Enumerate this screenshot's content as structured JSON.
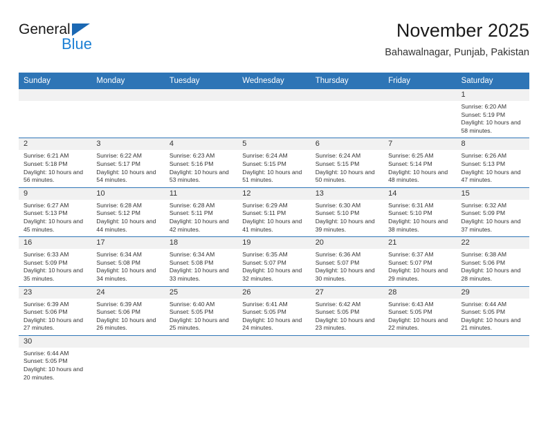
{
  "brand": {
    "name_top": "General",
    "name_bottom": "Blue",
    "logo_icon": "triangle-icon",
    "accent_color": "#1b7fd4"
  },
  "header": {
    "month_title": "November 2025",
    "location": "Bahawalnagar, Punjab, Pakistan"
  },
  "calendar": {
    "header_color": "#2e75b6",
    "weekdays": [
      "Sunday",
      "Monday",
      "Tuesday",
      "Wednesday",
      "Thursday",
      "Friday",
      "Saturday"
    ],
    "weeks": [
      [
        {
          "day": "",
          "empty": true
        },
        {
          "day": "",
          "empty": true
        },
        {
          "day": "",
          "empty": true
        },
        {
          "day": "",
          "empty": true
        },
        {
          "day": "",
          "empty": true
        },
        {
          "day": "",
          "empty": true
        },
        {
          "day": "1",
          "sunrise": "Sunrise: 6:20 AM",
          "sunset": "Sunset: 5:19 PM",
          "daylight": "Daylight: 10 hours and 58 minutes."
        }
      ],
      [
        {
          "day": "2",
          "sunrise": "Sunrise: 6:21 AM",
          "sunset": "Sunset: 5:18 PM",
          "daylight": "Daylight: 10 hours and 56 minutes."
        },
        {
          "day": "3",
          "sunrise": "Sunrise: 6:22 AM",
          "sunset": "Sunset: 5:17 PM",
          "daylight": "Daylight: 10 hours and 54 minutes."
        },
        {
          "day": "4",
          "sunrise": "Sunrise: 6:23 AM",
          "sunset": "Sunset: 5:16 PM",
          "daylight": "Daylight: 10 hours and 53 minutes."
        },
        {
          "day": "5",
          "sunrise": "Sunrise: 6:24 AM",
          "sunset": "Sunset: 5:15 PM",
          "daylight": "Daylight: 10 hours and 51 minutes."
        },
        {
          "day": "6",
          "sunrise": "Sunrise: 6:24 AM",
          "sunset": "Sunset: 5:15 PM",
          "daylight": "Daylight: 10 hours and 50 minutes."
        },
        {
          "day": "7",
          "sunrise": "Sunrise: 6:25 AM",
          "sunset": "Sunset: 5:14 PM",
          "daylight": "Daylight: 10 hours and 48 minutes."
        },
        {
          "day": "8",
          "sunrise": "Sunrise: 6:26 AM",
          "sunset": "Sunset: 5:13 PM",
          "daylight": "Daylight: 10 hours and 47 minutes."
        }
      ],
      [
        {
          "day": "9",
          "sunrise": "Sunrise: 6:27 AM",
          "sunset": "Sunset: 5:13 PM",
          "daylight": "Daylight: 10 hours and 45 minutes."
        },
        {
          "day": "10",
          "sunrise": "Sunrise: 6:28 AM",
          "sunset": "Sunset: 5:12 PM",
          "daylight": "Daylight: 10 hours and 44 minutes."
        },
        {
          "day": "11",
          "sunrise": "Sunrise: 6:28 AM",
          "sunset": "Sunset: 5:11 PM",
          "daylight": "Daylight: 10 hours and 42 minutes."
        },
        {
          "day": "12",
          "sunrise": "Sunrise: 6:29 AM",
          "sunset": "Sunset: 5:11 PM",
          "daylight": "Daylight: 10 hours and 41 minutes."
        },
        {
          "day": "13",
          "sunrise": "Sunrise: 6:30 AM",
          "sunset": "Sunset: 5:10 PM",
          "daylight": "Daylight: 10 hours and 39 minutes."
        },
        {
          "day": "14",
          "sunrise": "Sunrise: 6:31 AM",
          "sunset": "Sunset: 5:10 PM",
          "daylight": "Daylight: 10 hours and 38 minutes."
        },
        {
          "day": "15",
          "sunrise": "Sunrise: 6:32 AM",
          "sunset": "Sunset: 5:09 PM",
          "daylight": "Daylight: 10 hours and 37 minutes."
        }
      ],
      [
        {
          "day": "16",
          "sunrise": "Sunrise: 6:33 AM",
          "sunset": "Sunset: 5:09 PM",
          "daylight": "Daylight: 10 hours and 35 minutes."
        },
        {
          "day": "17",
          "sunrise": "Sunrise: 6:34 AM",
          "sunset": "Sunset: 5:08 PM",
          "daylight": "Daylight: 10 hours and 34 minutes."
        },
        {
          "day": "18",
          "sunrise": "Sunrise: 6:34 AM",
          "sunset": "Sunset: 5:08 PM",
          "daylight": "Daylight: 10 hours and 33 minutes."
        },
        {
          "day": "19",
          "sunrise": "Sunrise: 6:35 AM",
          "sunset": "Sunset: 5:07 PM",
          "daylight": "Daylight: 10 hours and 32 minutes."
        },
        {
          "day": "20",
          "sunrise": "Sunrise: 6:36 AM",
          "sunset": "Sunset: 5:07 PM",
          "daylight": "Daylight: 10 hours and 30 minutes."
        },
        {
          "day": "21",
          "sunrise": "Sunrise: 6:37 AM",
          "sunset": "Sunset: 5:07 PM",
          "daylight": "Daylight: 10 hours and 29 minutes."
        },
        {
          "day": "22",
          "sunrise": "Sunrise: 6:38 AM",
          "sunset": "Sunset: 5:06 PM",
          "daylight": "Daylight: 10 hours and 28 minutes."
        }
      ],
      [
        {
          "day": "23",
          "sunrise": "Sunrise: 6:39 AM",
          "sunset": "Sunset: 5:06 PM",
          "daylight": "Daylight: 10 hours and 27 minutes."
        },
        {
          "day": "24",
          "sunrise": "Sunrise: 6:39 AM",
          "sunset": "Sunset: 5:06 PM",
          "daylight": "Daylight: 10 hours and 26 minutes."
        },
        {
          "day": "25",
          "sunrise": "Sunrise: 6:40 AM",
          "sunset": "Sunset: 5:05 PM",
          "daylight": "Daylight: 10 hours and 25 minutes."
        },
        {
          "day": "26",
          "sunrise": "Sunrise: 6:41 AM",
          "sunset": "Sunset: 5:05 PM",
          "daylight": "Daylight: 10 hours and 24 minutes."
        },
        {
          "day": "27",
          "sunrise": "Sunrise: 6:42 AM",
          "sunset": "Sunset: 5:05 PM",
          "daylight": "Daylight: 10 hours and 23 minutes."
        },
        {
          "day": "28",
          "sunrise": "Sunrise: 6:43 AM",
          "sunset": "Sunset: 5:05 PM",
          "daylight": "Daylight: 10 hours and 22 minutes."
        },
        {
          "day": "29",
          "sunrise": "Sunrise: 6:44 AM",
          "sunset": "Sunset: 5:05 PM",
          "daylight": "Daylight: 10 hours and 21 minutes."
        }
      ],
      [
        {
          "day": "30",
          "sunrise": "Sunrise: 6:44 AM",
          "sunset": "Sunset: 5:05 PM",
          "daylight": "Daylight: 10 hours and 20 minutes."
        },
        {
          "day": "",
          "empty": true
        },
        {
          "day": "",
          "empty": true
        },
        {
          "day": "",
          "empty": true
        },
        {
          "day": "",
          "empty": true
        },
        {
          "day": "",
          "empty": true
        },
        {
          "day": "",
          "empty": true
        }
      ]
    ]
  }
}
